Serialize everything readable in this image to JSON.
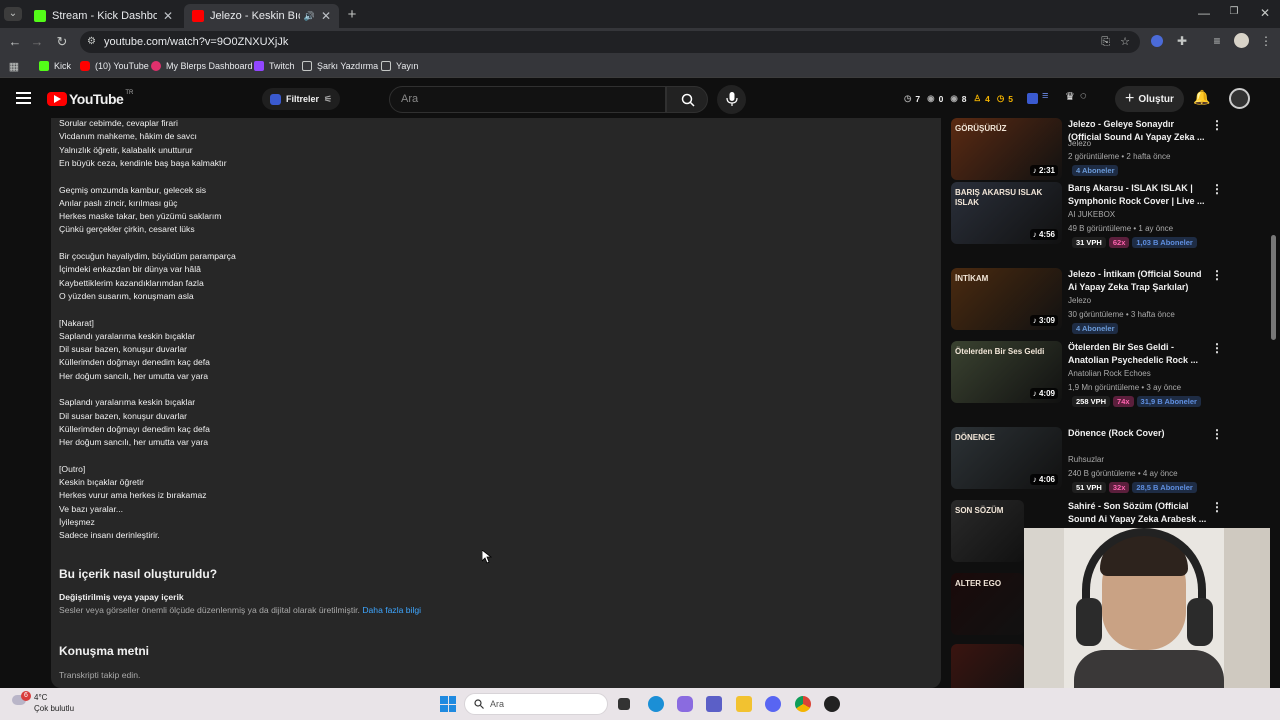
{
  "tabs": [
    {
      "title": "Stream - Kick Dashboard",
      "active": false,
      "favicon_color": "#53fc18"
    },
    {
      "title": "Jelezo - Keskin Bıçaklar (Of",
      "active": true,
      "favicon_color": "#ff0000"
    }
  ],
  "new_tab_label": "+",
  "url": "youtube.com/watch?v=9O0ZNXUXjJk",
  "bookmarks": [
    {
      "label": "Kick",
      "color": "#53fc18"
    },
    {
      "label": "(10) YouTube",
      "color": "#ff0000"
    },
    {
      "label": "My Blerps Dashboard",
      "color": "#e0306c"
    },
    {
      "label": "Twitch",
      "color": "#9146ff"
    },
    {
      "label": "Şarkı Yazdırma",
      "color": "folder"
    },
    {
      "label": "Yayın",
      "color": "folder"
    }
  ],
  "yt": {
    "logo_text": "YouTube",
    "region": "TR",
    "filters_label": "Filtreler",
    "search_placeholder": "Ara",
    "stats": [
      "7",
      "0",
      "8",
      "4",
      "5"
    ],
    "create_label": "Oluştur"
  },
  "lyrics": [
    "Sorular cebimde, cevaplar firari",
    "Vicdanım mahkeme, hâkim de savcı",
    "Yalnızlık öğretir, kalabalık unutturur",
    "En büyük ceza, kendinle baş başa kalmaktır",
    "",
    "Geçmiş omzumda kambur, gelecek sis",
    "Anılar paslı zincir, kırılması güç",
    "Herkes maske takar, ben yüzümü saklarım",
    "Çünkü gerçekler çirkin, cesaret lüks",
    "",
    "Bir çocuğun hayaliydim, büyüdüm paramparça",
    "İçimdeki enkazdan bir dünya var hâlâ",
    "Kaybettiklerim kazandıklarımdan fazla",
    "O yüzden susarım, konuşmam asla",
    "",
    "[Nakarat]",
    "Saplandı yaralarıma keskin bıçaklar",
    "Dil susar bazen, konuşur duvarlar",
    "Küllerimden doğmayı denedim kaç defa",
    "Her doğum sancılı, her umutta var yara",
    "",
    "Saplandı yaralarıma keskin bıçaklar",
    "Dil susar bazen, konuşur duvarlar",
    "Küllerimden doğmayı denedim kaç defa",
    "Her doğum sancılı, her umutta var yara",
    "",
    "[Outro]",
    "Keskin bıçaklar öğretir",
    "Herkes vurur ama herkes iz bırakamaz",
    "Ve bazı yaralar...",
    "İyileşmez",
    "Sadece insanı derinleştirir."
  ],
  "how_made": {
    "heading": "Bu içerik nasıl oluşturuldu?",
    "subheading": "Değiştirilmiş veya yapay içerik",
    "text": "Sesler veya görseller önemli ölçüde düzenlenmiş ya da dijital olarak üretilmiştir.",
    "link": "Daha fazla bilgi"
  },
  "transcript": {
    "heading": "Konuşma metni",
    "text": "Transkripti takip edin."
  },
  "related": [
    {
      "title": "Jelezo - Geleye Sonaydır (Official Sound Aı Yapay Zeka ...",
      "channel": "Jelezo",
      "meta": "2 görüntüleme • 2 hafta önce",
      "duration": "2:31",
      "chips": [
        {
          "t": "4 Aboneler",
          "k": "sub4"
        }
      ],
      "thumb_text": "GÖRÜŞÜRÜZ",
      "thumb_color": "#5a2a12"
    },
    {
      "title": "Barış Akarsu - ISLAK ISLAK | Symphonic Rock Cover | Live ...",
      "channel": "AI JUKEBOX",
      "meta": "49 B görüntüleme • 1 ay önce",
      "duration": "4:56",
      "chips": [
        {
          "t": "31 VPH",
          "k": "vph"
        },
        {
          "t": "62x",
          "k": "x"
        },
        {
          "t": "1,03 B Aboneler",
          "k": "sub"
        }
      ],
      "thumb_text": "BARIŞ AKARSU ISLAK ISLAK",
      "thumb_color": "#2a2f3a"
    },
    {
      "title": "Jelezo - İntikam (Official Sound Ai Yapay Zeka Trap Şarkılar)",
      "channel": "Jelezo",
      "meta": "30 görüntüleme • 3 hafta önce",
      "duration": "3:09",
      "chips": [
        {
          "t": "4 Aboneler",
          "k": "sub4"
        }
      ],
      "thumb_text": "İNTİKAM",
      "thumb_color": "#4a2a10"
    },
    {
      "title": "Ötelerden Bir Ses Geldi - Anatolian Psychedelic Rock ...",
      "channel": "Anatolian Rock Echoes",
      "meta": "1,9 Mn görüntüleme • 3 ay önce",
      "duration": "4:09",
      "chips": [
        {
          "t": "258 VPH",
          "k": "vph"
        },
        {
          "t": "74x",
          "k": "x"
        },
        {
          "t": "31,9 B Aboneler",
          "k": "sub"
        }
      ],
      "thumb_text": "Ötelerden Bir Ses Geldi",
      "thumb_color": "#3a4230"
    },
    {
      "title": "Dönence (Rock Cover)",
      "channel": "Ruhsuzlar",
      "meta": "240 B görüntüleme • 4 ay önce",
      "duration": "4:06",
      "chips": [
        {
          "t": "51 VPH",
          "k": "vph"
        },
        {
          "t": "32x",
          "k": "x"
        },
        {
          "t": "28,5 B Aboneler",
          "k": "sub"
        }
      ],
      "thumb_text": "DÖNENCE",
      "thumb_color": "#2c3236"
    },
    {
      "title": "Sahiré - Son Sözüm (Official Sound Ai Yapay Zeka Arabesk ...",
      "channel": "",
      "meta": "",
      "duration": "",
      "chips": [],
      "thumb_text": "SON SÖZÜM",
      "thumb_color": "#2a2a2a"
    },
    {
      "title": "",
      "channel": "",
      "meta": "",
      "duration": "",
      "chips": [],
      "thumb_text": "ALTER EGO",
      "thumb_color": "#1a0a0a"
    },
    {
      "title": "",
      "channel": "",
      "meta": "",
      "duration": "",
      "chips": [],
      "thumb_text": "",
      "thumb_color": "#3a1410"
    }
  ],
  "taskbar": {
    "weather_temp": "4°C",
    "weather_desc": "Çok bulutlu",
    "weather_badge": "6",
    "search_placeholder": "Ara"
  }
}
